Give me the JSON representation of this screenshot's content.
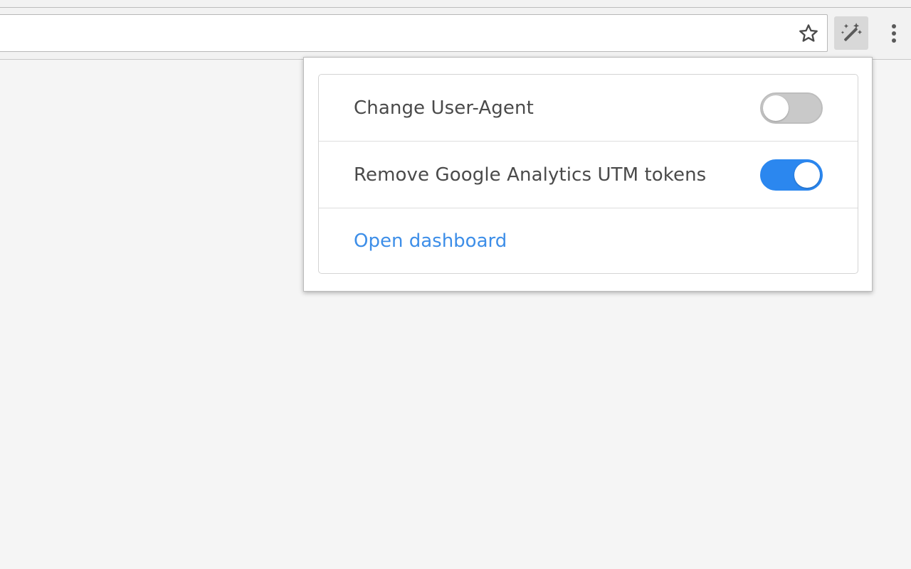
{
  "toolbar": {
    "bookmark_icon": "star-outline-icon",
    "extension_icon": "magic-wand-icon",
    "menu_icon": "vertical-dots-icon"
  },
  "popup": {
    "items": [
      {
        "label": "Change User-Agent",
        "toggle_state": "off"
      },
      {
        "label": "Remove Google Analytics UTM tokens",
        "toggle_state": "on"
      }
    ],
    "dashboard_link": "Open dashboard"
  },
  "colors": {
    "toggle_on": "#2b87ef",
    "toggle_off": "#c9c9c9",
    "link": "#3d8ee8",
    "text": "#4a4a4a"
  }
}
